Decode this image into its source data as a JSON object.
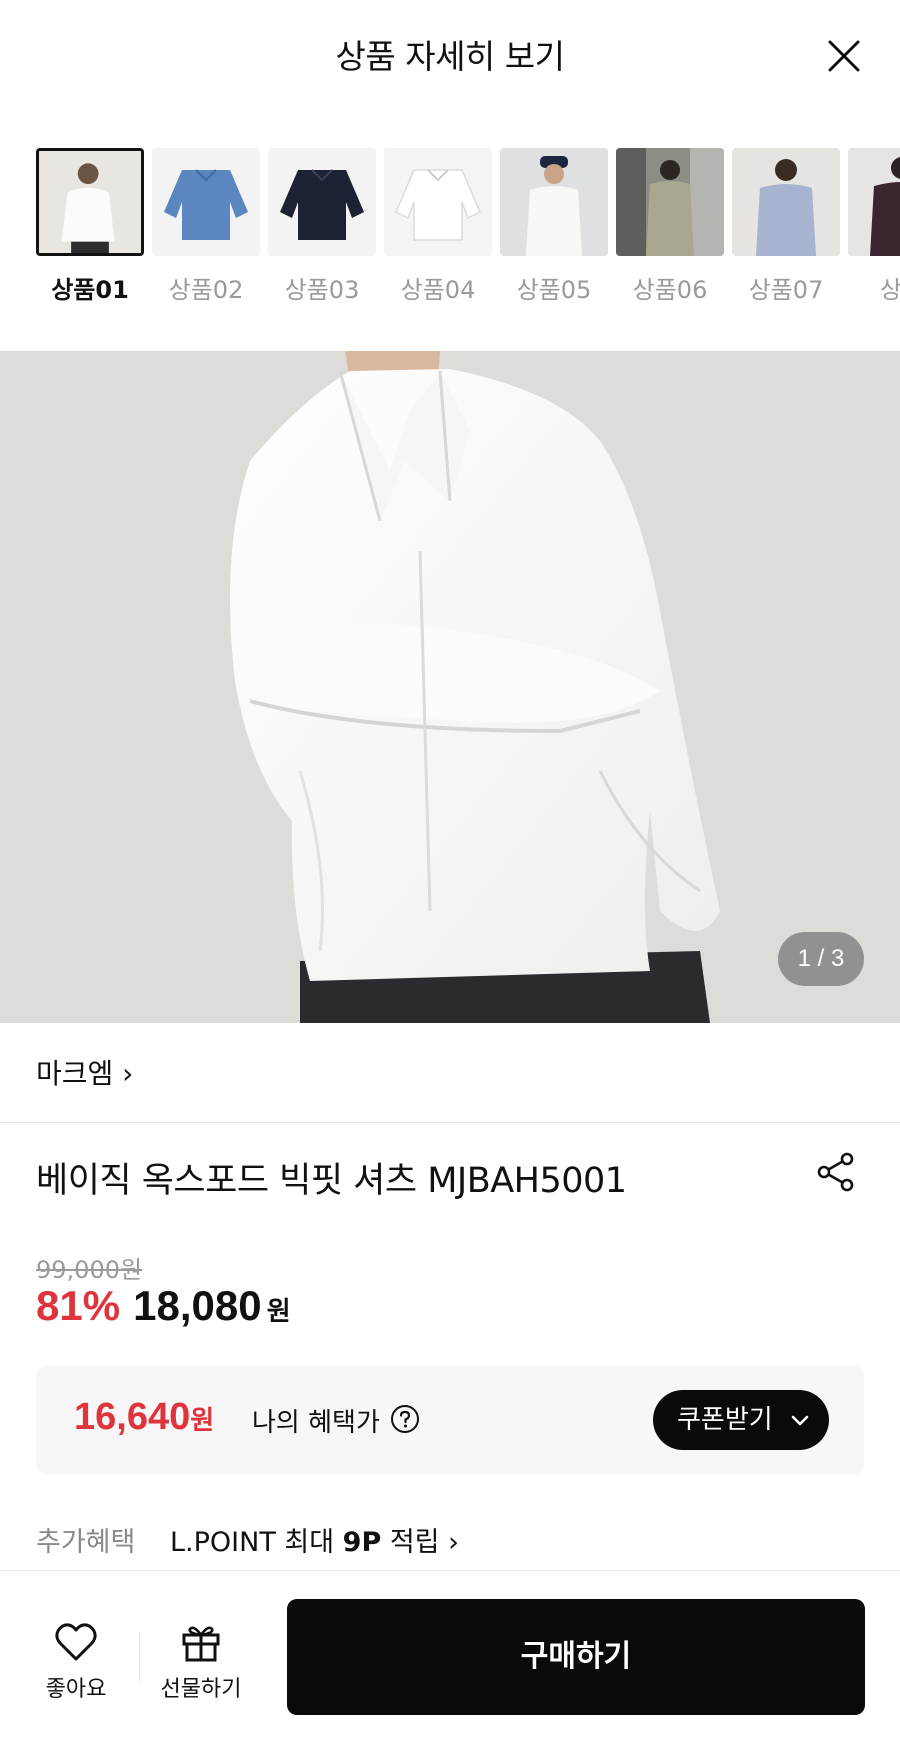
{
  "header": {
    "title": "상품 자세히 보기",
    "close_icon": "close-icon"
  },
  "thumbnails": [
    {
      "label": "상품01",
      "active": true,
      "color": "#e9e6e1"
    },
    {
      "label": "상품02",
      "active": false,
      "color": "#5b86bf"
    },
    {
      "label": "상품03",
      "active": false,
      "color": "#1c2233"
    },
    {
      "label": "상품04",
      "active": false,
      "color": "#f1f2f5"
    },
    {
      "label": "상품05",
      "active": false,
      "color": "#e4e5e6"
    },
    {
      "label": "상품06",
      "active": false,
      "color": "#a9a88f"
    },
    {
      "label": "상품07",
      "active": false,
      "color": "#a7b3cf"
    },
    {
      "label": "상품",
      "active": false,
      "color": "#3a2530"
    }
  ],
  "hero": {
    "page_indicator": "1 / 3"
  },
  "brand": {
    "name": "마크엠 ›"
  },
  "product": {
    "name": "베이직 옥스포드 빅핏 셔츠 MJBAH5001",
    "original_price": "99,000원",
    "discount": "81%",
    "sale_price": "18,080",
    "won": "원"
  },
  "benefit": {
    "price": "16,640",
    "won": "원",
    "label": "나의 혜택가",
    "coupon_button": "쿠폰받기"
  },
  "extra": {
    "label": "추가혜택",
    "text_prefix": "L.POINT 최대 ",
    "text_bold": "9P",
    "text_suffix": " 적립 ›"
  },
  "bottom_bar": {
    "like_label": "좋아요",
    "gift_label": "선물하기",
    "buy_label": "구매하기"
  },
  "colors": {
    "accent_red": "#e0343d",
    "dark": "#0a0a0a"
  }
}
